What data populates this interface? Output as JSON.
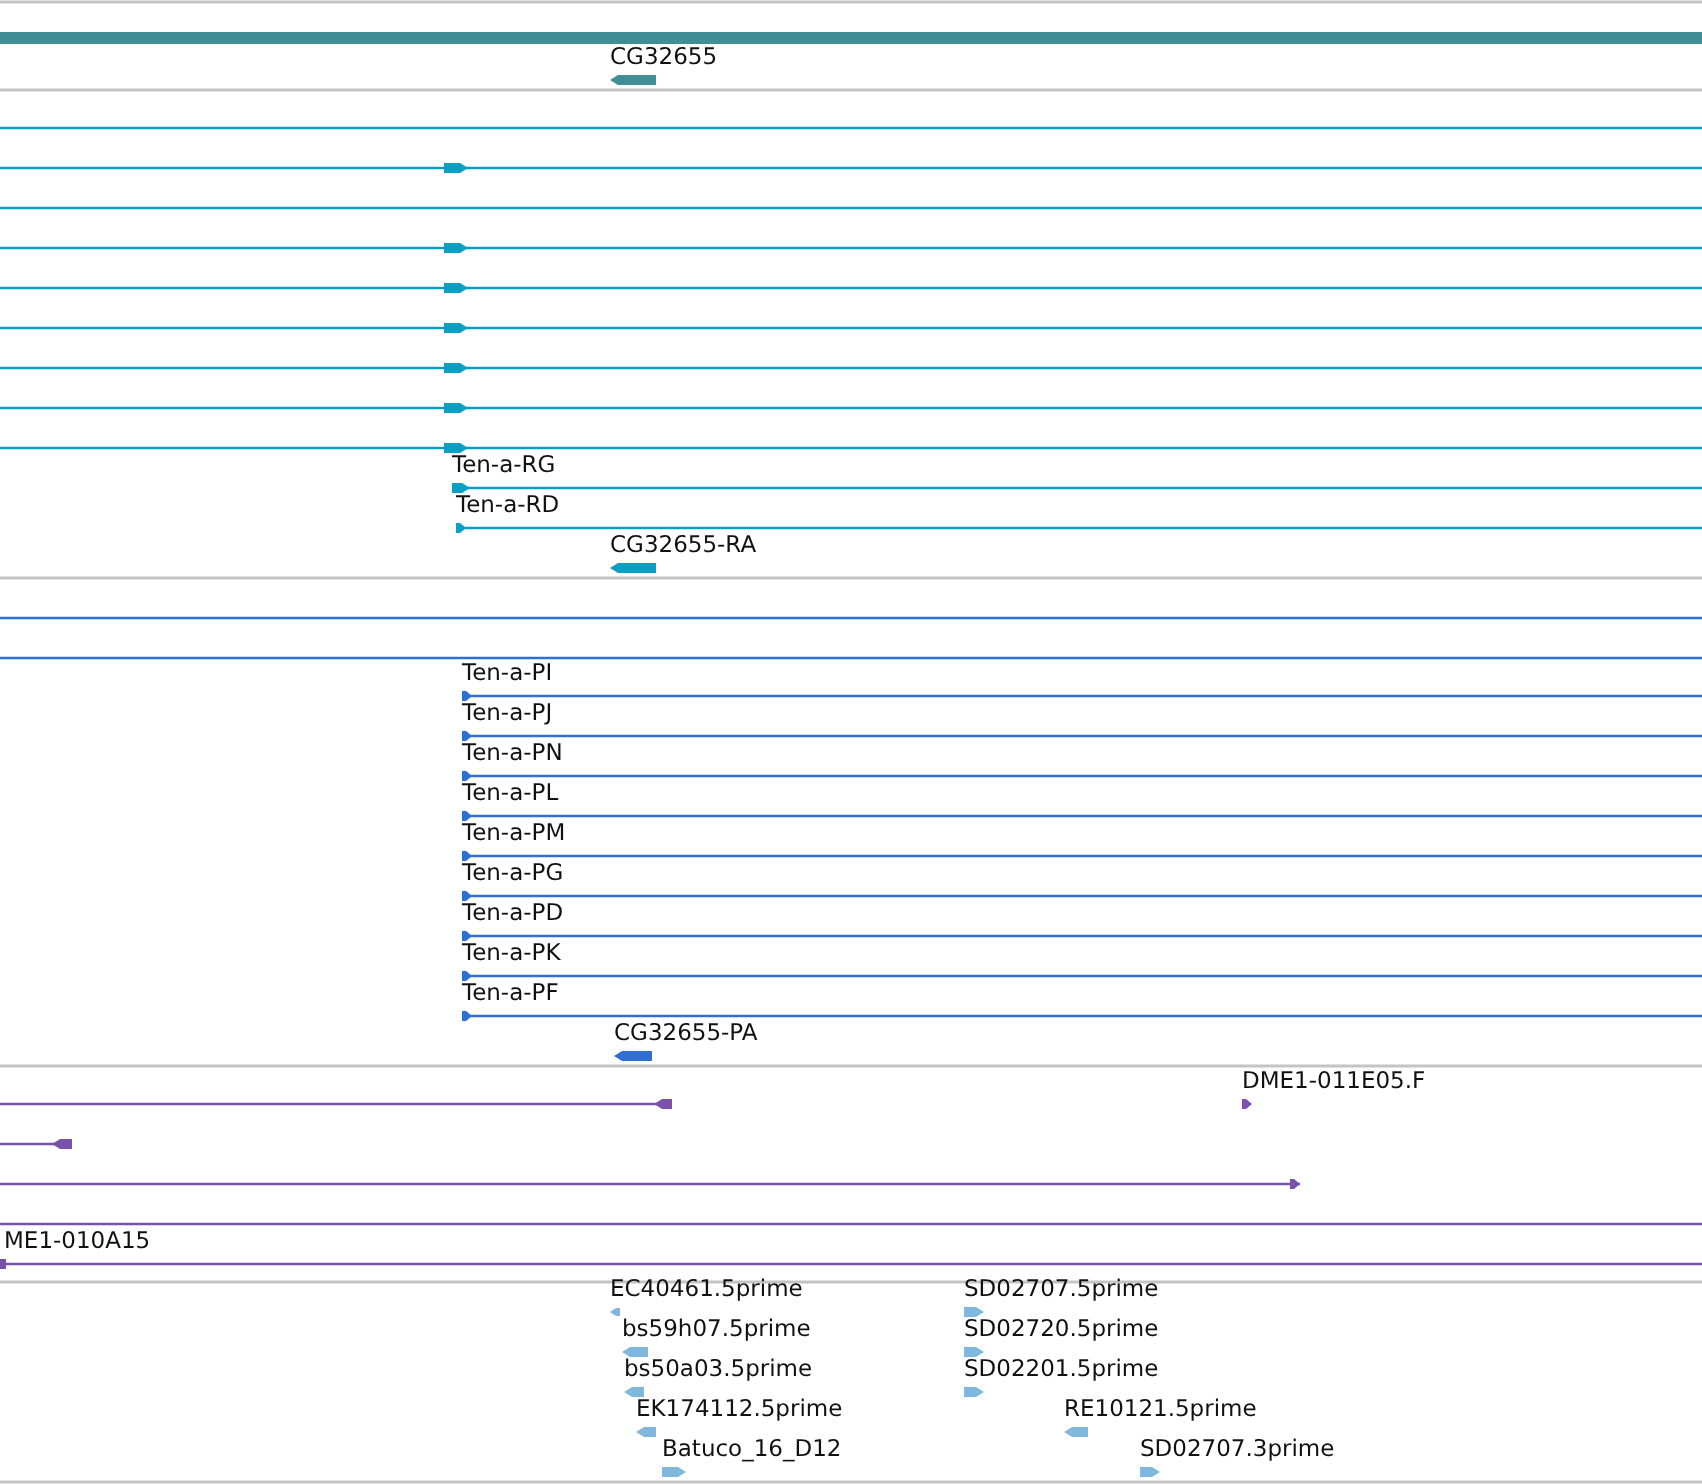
{
  "tracks": [
    {
      "color": "#3f8f94",
      "features": [
        {
          "kind": "bar"
        },
        {
          "kind": "arrow",
          "label": "CG32655",
          "reverse": true
        }
      ]
    },
    {
      "color": "#0a9ec2",
      "features": [
        {
          "kind": "line"
        },
        {
          "kind": "arrow",
          "reverse": false
        },
        {
          "kind": "line"
        },
        {
          "kind": "arrow",
          "reverse": false
        },
        {
          "kind": "arrow",
          "reverse": false
        },
        {
          "kind": "arrow",
          "reverse": false
        },
        {
          "kind": "arrow",
          "reverse": false
        },
        {
          "kind": "arrow",
          "reverse": false
        },
        {
          "kind": "arrow",
          "reverse": false
        },
        {
          "kind": "arrow",
          "label": "Ten-a-RG",
          "reverse": false
        },
        {
          "kind": "arrow",
          "label": "Ten-a-RD",
          "reverse": false
        },
        {
          "kind": "arrow",
          "label": "CG32655-RA",
          "reverse": true
        }
      ]
    },
    {
      "color": "#2e6fd0",
      "features": [
        {
          "kind": "line"
        },
        {
          "kind": "line"
        },
        {
          "kind": "arrow",
          "label": "Ten-a-PI",
          "reverse": false
        },
        {
          "kind": "arrow",
          "label": "Ten-a-PJ",
          "reverse": false
        },
        {
          "kind": "arrow",
          "label": "Ten-a-PN",
          "reverse": false
        },
        {
          "kind": "arrow",
          "label": "Ten-a-PL",
          "reverse": false
        },
        {
          "kind": "arrow",
          "label": "Ten-a-PM",
          "reverse": false
        },
        {
          "kind": "arrow",
          "label": "Ten-a-PG",
          "reverse": false
        },
        {
          "kind": "arrow",
          "label": "Ten-a-PD",
          "reverse": false
        },
        {
          "kind": "arrow",
          "label": "Ten-a-PK",
          "reverse": false
        },
        {
          "kind": "arrow",
          "label": "Ten-a-PF",
          "reverse": false
        },
        {
          "kind": "arrow",
          "label": "CG32655-PA",
          "reverse": true
        }
      ]
    },
    {
      "color": "#7a52ad",
      "features": [
        {
          "kind": "arrow",
          "reverse": true
        },
        {
          "kind": "arrow",
          "label": "DME1-011E05.F",
          "reverse": false
        },
        {
          "kind": "arrow",
          "reverse": true
        },
        {
          "kind": "arrow",
          "reverse": false
        },
        {
          "kind": "line"
        },
        {
          "kind": "bar",
          "label": "ME1-010A15"
        }
      ]
    },
    {
      "color": "#80b8dd",
      "features": [
        {
          "kind": "arrow",
          "label": "EC40461.5prime",
          "reverse": true
        },
        {
          "kind": "arrow",
          "label": "bs59h07.5prime",
          "reverse": true
        },
        {
          "kind": "arrow",
          "label": "bs50a03.5prime",
          "reverse": true
        },
        {
          "kind": "arrow",
          "label": "EK174112.5prime",
          "reverse": true
        },
        {
          "kind": "arrow",
          "label": "Batuco_16_D12",
          "reverse": false
        },
        {
          "kind": "arrow",
          "label": "SD02707.5prime",
          "reverse": false
        },
        {
          "kind": "arrow",
          "label": "SD02720.5prime",
          "reverse": false
        },
        {
          "kind": "arrow",
          "label": "SD02201.5prime",
          "reverse": false
        },
        {
          "kind": "arrow",
          "label": "RE10121.5prime",
          "reverse": true
        },
        {
          "kind": "arrow",
          "label": "SD02707.3prime",
          "reverse": false
        }
      ]
    }
  ]
}
